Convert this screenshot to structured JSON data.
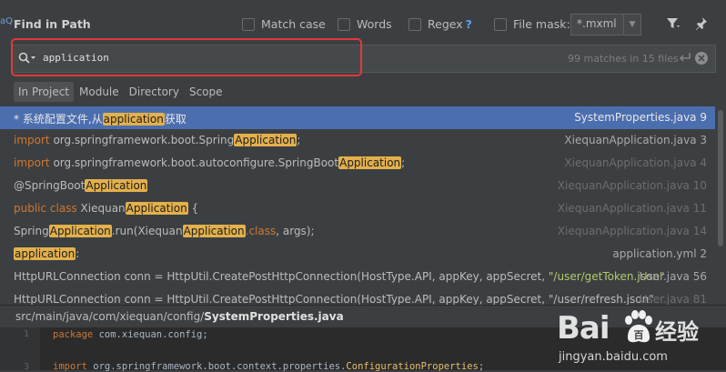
{
  "dialog": {
    "title": "Find in Path",
    "options": {
      "match_case": "Match case",
      "words": "Words",
      "regex": "Regex",
      "regex_help": "?",
      "file_mask": "File mask:",
      "file_mask_value": "*.mxml"
    }
  },
  "search": {
    "query": "application",
    "matches": "99 matches in 15 files"
  },
  "scopes": [
    "In Project",
    "Module",
    "Directory",
    "Scope"
  ],
  "results": [
    {
      "parts": [
        {
          "t": "* 系统配置文件,从"
        },
        {
          "t": "application",
          "h": true
        },
        {
          "t": "获取"
        }
      ],
      "file": "SystemProperties.java 9",
      "selected": true
    },
    {
      "parts": [
        {
          "t": "import ",
          "k": true
        },
        {
          "t": "org.springframework.boot.Spring"
        },
        {
          "t": "Application",
          "h": true
        },
        {
          "t": ";"
        }
      ],
      "file": "XiequanApplication.java 3"
    },
    {
      "parts": [
        {
          "t": "import ",
          "k": true
        },
        {
          "t": "org.springframework.boot.autoconfigure.SpringBoot"
        },
        {
          "t": "Application",
          "h": true
        },
        {
          "t": ";"
        }
      ],
      "file": "XiequanApplication.java 4",
      "dim": true
    },
    {
      "parts": [
        {
          "t": "@SpringBoot"
        },
        {
          "t": "Application",
          "h": true
        }
      ],
      "file": "XiequanApplication.java 10",
      "dim": true
    },
    {
      "parts": [
        {
          "t": "public class ",
          "k": true
        },
        {
          "t": "Xiequan"
        },
        {
          "t": "Application",
          "h": true
        },
        {
          "t": " {"
        }
      ],
      "file": "XiequanApplication.java 11",
      "dim": true
    },
    {
      "parts": [
        {
          "t": "Spring"
        },
        {
          "t": "Application",
          "h": true
        },
        {
          "t": ".run(Xiequan"
        },
        {
          "t": "Application",
          "h": true
        },
        {
          "t": ".class",
          "k": true
        },
        {
          "t": ", args);"
        }
      ],
      "file": "XiequanApplication.java 14",
      "dim": true
    },
    {
      "parts": [
        {
          "t": "application",
          "h": true
        },
        {
          "t": ":"
        }
      ],
      "file": "application.yml 2"
    },
    {
      "parts": [
        {
          "t": "HttpURLConnection conn = HttpUtil.CreatePostHttpConnection(HostType.API, appKey, appSecret, "
        },
        {
          "t": "\"/user/getToken.json\"",
          "s": true
        }
      ],
      "file": "User.java 56"
    },
    {
      "parts": [
        {
          "t": "HttpURLConnection conn = HttpUtil.CreatePostHttpConnection(HostType.API, appKey, appSecret, \"/user/refresh.json\""
        }
      ],
      "file": "User.java 81",
      "dim": true
    }
  ],
  "path": {
    "dir": "src/main/java/com/xiequan/config/",
    "file": "SystemProperties.java"
  },
  "preview": {
    "line1_num": "1",
    "line1_kw": "package",
    "line1_rest": " com.xiequan.config;",
    "line2_num": "3",
    "line2_kw": "import",
    "line2_rest": " org.springframework.boot.context.properties.",
    "line2_cls": "ConfigurationProperties",
    "line2_end": ";"
  },
  "watermark": {
    "logo": "Bai",
    "logo_end": "百",
    "cn": "经验",
    "url": "jingyan.baidu.com"
  },
  "colors": {
    "highlight": "#e3b04b",
    "selection": "#4b6eaf",
    "keyword": "#cc7832",
    "annotation_box": "#e03a3a"
  }
}
